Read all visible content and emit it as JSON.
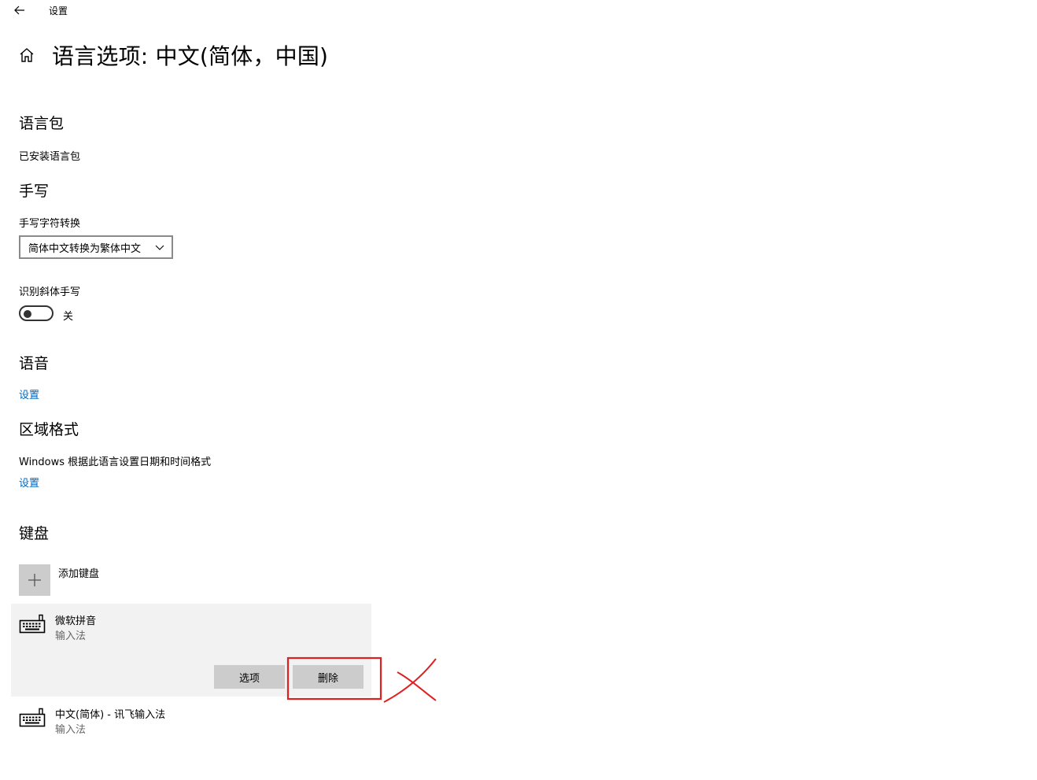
{
  "titlebar": {
    "app_title": "设置",
    "back_icon": "back-arrow-icon"
  },
  "header": {
    "title": "语言选项: 中文(简体，中国)",
    "home_icon": "home-icon"
  },
  "language_pack": {
    "heading": "语言包",
    "status": "已安装语言包"
  },
  "handwriting": {
    "heading": "手写",
    "conversion_label": "手写字符转换",
    "conversion_value": "简体中文转换为繁体中文",
    "italic_label": "识别斜体手写",
    "italic_state": "关"
  },
  "speech": {
    "heading": "语音",
    "settings_link": "设置"
  },
  "regional": {
    "heading": "区域格式",
    "description": "Windows 根据此语言设置日期和时间格式",
    "settings_link": "设置"
  },
  "keyboard": {
    "heading": "键盘",
    "add_label": "添加键盘",
    "items": [
      {
        "name": "微软拼音",
        "type": "输入法",
        "options_label": "选项",
        "delete_label": "删除"
      },
      {
        "name": "中文(简体) - 讯飞输入法",
        "type": "输入法"
      }
    ]
  },
  "colors": {
    "accent": "#0067c0",
    "annotation": "#e02020",
    "panel": "#f2f2f2",
    "button": "#cccccc"
  }
}
